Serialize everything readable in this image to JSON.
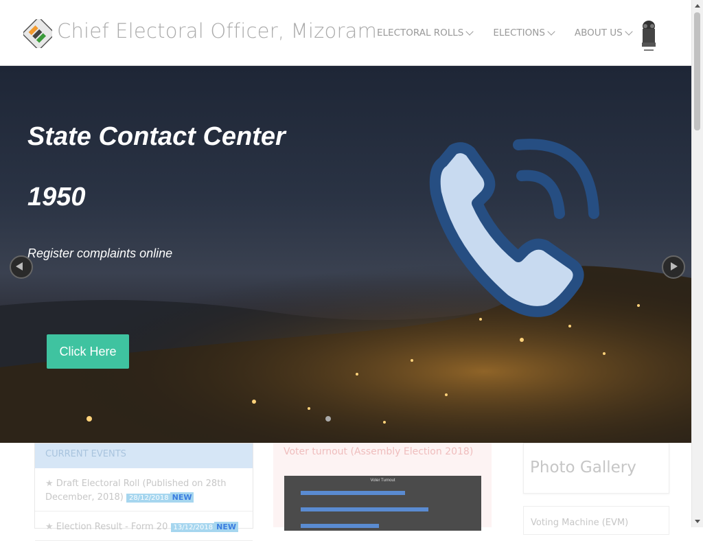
{
  "header": {
    "site_title": "Chief Electoral Officer, Mizoram",
    "nav": [
      {
        "label": "ELECTORAL ROLLS"
      },
      {
        "label": "ELECTIONS"
      },
      {
        "label": "ABOUT US"
      }
    ]
  },
  "hero": {
    "title": "State Contact Center",
    "number": "1950",
    "subtitle": "Register complaints online",
    "button_label": "Click Here"
  },
  "current_events": {
    "heading": "CURRENT EVENTS",
    "items": [
      {
        "text": "Draft Electoral Roll (Published on 28th December, 2018)",
        "date": "28/12/2018",
        "badge": "NEW"
      },
      {
        "text": "Election Result - Form 20",
        "date": "13/12/2018",
        "badge": "NEW"
      }
    ]
  },
  "voter_turnout": {
    "heading": "Voter turnout (Assembly Election 2018)",
    "chart_title": "Voter Turnout"
  },
  "photo_gallery": {
    "heading": "Photo Gallery"
  },
  "evm": {
    "heading": "Voting Machine (EVM)"
  },
  "colors": {
    "accent": "#3fc3a0",
    "events_header": "#d6e6f6"
  },
  "icons": [
    "ballot-logo-icon",
    "chevron-down-icon",
    "national-emblem-icon",
    "phone-icon",
    "arrow-left-icon",
    "arrow-right-icon",
    "star-icon"
  ]
}
